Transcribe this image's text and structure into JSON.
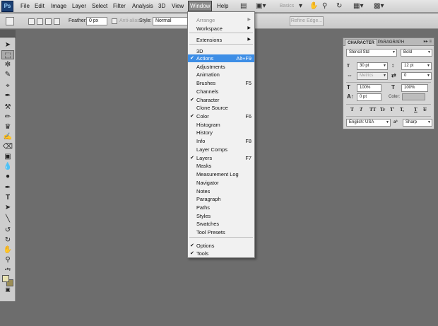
{
  "app": {
    "logo": "Ps"
  },
  "menubar": {
    "items": [
      "File",
      "Edit",
      "Image",
      "Layer",
      "Select",
      "Filter",
      "Analysis",
      "3D",
      "View",
      "Window",
      "Help"
    ],
    "active": "Window",
    "disabled_button": "Basics"
  },
  "options": {
    "feather_label": "Feather:",
    "feather_value": "0 px",
    "antialias_label": "Anti-alias",
    "style_label": "Style:",
    "style_value": "Normal",
    "refine_edge": "Refine Edge..."
  },
  "window_menu": {
    "items": [
      {
        "label": "Arrange",
        "submenu": true,
        "disabled": true
      },
      {
        "label": "Workspace",
        "submenu": true
      },
      {
        "label": "Extensions",
        "submenu": true
      },
      {
        "label": "3D"
      },
      {
        "label": "Actions",
        "shortcut": "Alt+F9",
        "checked": true,
        "highlighted": true
      },
      {
        "label": "Adjustments"
      },
      {
        "label": "Animation"
      },
      {
        "label": "Brushes",
        "shortcut": "F5"
      },
      {
        "label": "Channels"
      },
      {
        "label": "Character",
        "checked": true
      },
      {
        "label": "Clone Source"
      },
      {
        "label": "Color",
        "shortcut": "F6",
        "checked": true
      },
      {
        "label": "Histogram"
      },
      {
        "label": "History"
      },
      {
        "label": "Info",
        "shortcut": "F8"
      },
      {
        "label": "Layer Comps"
      },
      {
        "label": "Layers",
        "shortcut": "F7",
        "checked": true
      },
      {
        "label": "Masks"
      },
      {
        "label": "Measurement Log"
      },
      {
        "label": "Navigator"
      },
      {
        "label": "Notes"
      },
      {
        "label": "Paragraph"
      },
      {
        "label": "Paths"
      },
      {
        "label": "Styles"
      },
      {
        "label": "Swatches"
      },
      {
        "label": "Tool Presets"
      },
      {
        "label": "Options",
        "checked": true
      },
      {
        "label": "Tools",
        "checked": true
      }
    ]
  },
  "character_panel": {
    "tabs": [
      "CHARACTER",
      "PARAGRAPH"
    ],
    "font_family": "Stencil Std",
    "font_style": "Bold",
    "font_size": "30 pt",
    "leading": "12 pt",
    "kerning": "Metrics",
    "tracking": "0",
    "vertical_scale": "100%",
    "horizontal_scale": "100%",
    "baseline_shift": "0 pt",
    "color_label": "Color:",
    "language": "English: USA",
    "antialias": "Sharp",
    "aa_label": "aª",
    "type_buttons": [
      "T",
      "T",
      "TT",
      "Tr",
      "T'",
      "T,",
      "T",
      "T"
    ]
  },
  "colors": {
    "canvas": "#6d6d6d",
    "highlight": "#3d8ee6",
    "foreground": "#e9e3b2",
    "background": "#9b8d56"
  }
}
